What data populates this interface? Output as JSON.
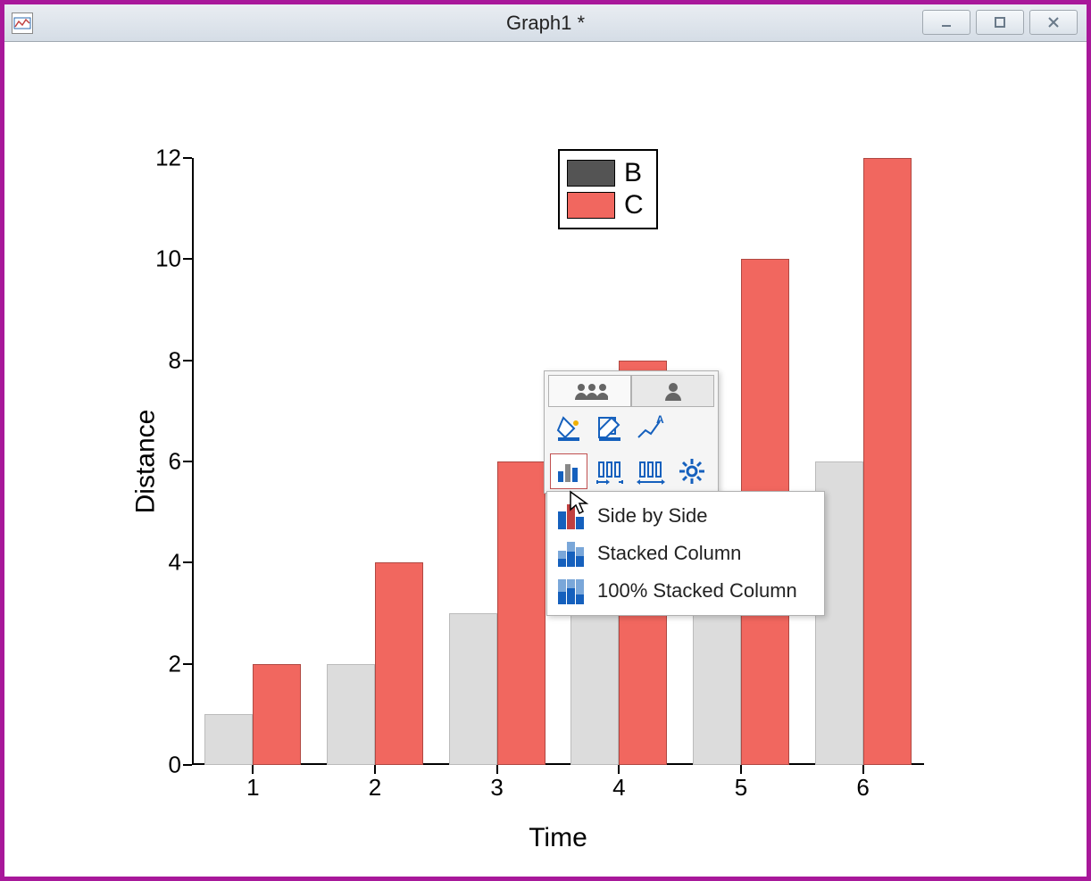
{
  "window": {
    "title": "Graph1 *",
    "layer_number": "1"
  },
  "chart_data": {
    "type": "bar",
    "title": "",
    "xlabel": "Time",
    "ylabel": "Distance",
    "categories": [
      "1",
      "2",
      "3",
      "4",
      "5",
      "6"
    ],
    "series": [
      {
        "name": "B",
        "color": "#dcdcdc",
        "values": [
          1,
          2,
          3,
          4,
          5,
          6
        ]
      },
      {
        "name": "C",
        "color": "#f1675f",
        "values": [
          2,
          4,
          6,
          8,
          10,
          12
        ]
      }
    ],
    "ylim": [
      0,
      12
    ],
    "y_ticks": [
      0,
      2,
      4,
      6,
      8,
      10,
      12
    ],
    "legend": {
      "entries": [
        "B",
        "C"
      ]
    }
  },
  "mini_toolbar": {
    "tabs": {
      "group_label": "Group",
      "single_label": "Single"
    },
    "tools": {
      "fill": "fill-style",
      "edit": "edit-style",
      "label": "data-label",
      "column_type": "column-type",
      "pattern1": "bar-gap",
      "pattern2": "bar-overlap",
      "settings": "settings"
    },
    "column_type_menu": {
      "side_by_side": "Side by Side",
      "stacked": "Stacked Column",
      "stacked_100": "100% Stacked Column"
    }
  }
}
